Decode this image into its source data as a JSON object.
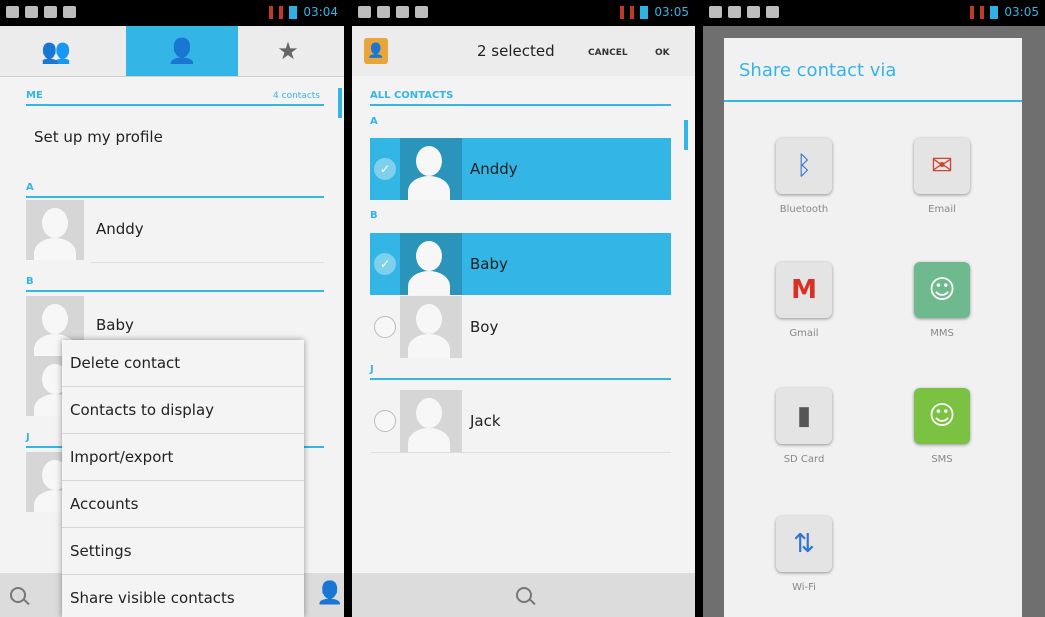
{
  "screen1": {
    "status_time": "03:04",
    "tabs": [
      {
        "icon": "groups-icon"
      },
      {
        "icon": "person-icon"
      },
      {
        "icon": "star-icon"
      }
    ],
    "section_me": "ME",
    "contacts_count": "4 contacts",
    "profile_text": "Set up my profile",
    "letters": [
      "A",
      "B",
      "J"
    ],
    "contacts": [
      "Anddy",
      "Baby"
    ],
    "menu": [
      "Delete contact",
      "Contacts to display",
      "Import/export",
      "Accounts",
      "Settings",
      "Share visible contacts"
    ]
  },
  "screen2": {
    "status_time": "03:05",
    "selected_label": "2 selected",
    "cancel_label": "CANCEL",
    "ok_label": "OK",
    "section_all": "ALL CONTACTS",
    "letters": [
      "A",
      "B",
      "J"
    ],
    "contacts": [
      {
        "name": "Anddy",
        "selected": true
      },
      {
        "name": "Baby",
        "selected": true
      },
      {
        "name": "Boy",
        "selected": false
      },
      {
        "name": "Jack",
        "selected": false
      }
    ]
  },
  "screen3": {
    "status_time": "03:05",
    "dialog_title": "Share contact via",
    "apps": [
      {
        "label": "Bluetooth",
        "icon": "bluetooth-icon",
        "color": "#2f73d6"
      },
      {
        "label": "Email",
        "icon": "email-icon",
        "color": "#c9472f"
      },
      {
        "label": "Gmail",
        "icon": "gmail-icon",
        "color": "#d93025"
      },
      {
        "label": "MMS",
        "icon": "mms-icon",
        "color": "#6fb98f"
      },
      {
        "label": "SD Card",
        "icon": "sdcard-icon",
        "color": "#555555"
      },
      {
        "label": "SMS",
        "icon": "sms-icon",
        "color": "#7cc242"
      },
      {
        "label": "Wi-Fi",
        "icon": "wifi-icon",
        "color": "#2f73d6"
      }
    ]
  },
  "colors": {
    "accent": "#33b5e5"
  }
}
